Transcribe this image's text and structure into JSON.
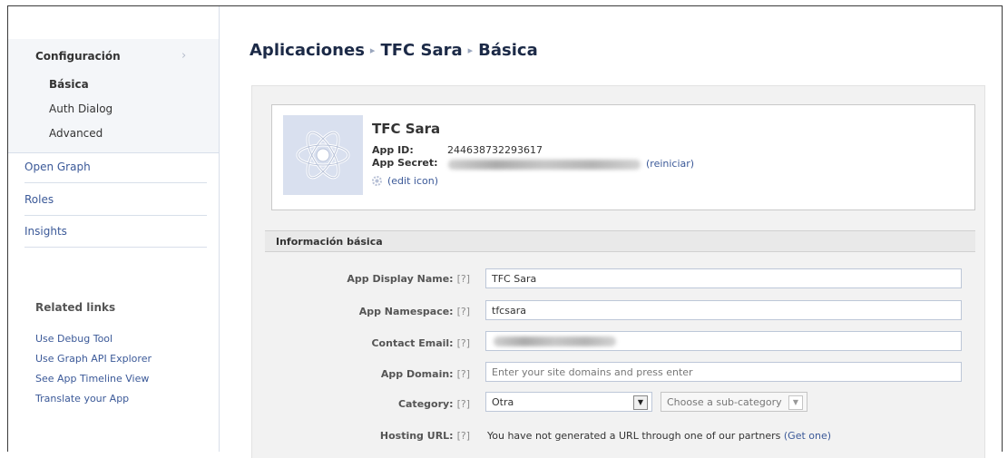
{
  "sidebar": {
    "settings_label": "Configuración",
    "settings_chevron": "›",
    "sub_items": [
      {
        "label": "Básica",
        "active": true
      },
      {
        "label": "Auth Dialog",
        "active": false
      },
      {
        "label": "Advanced",
        "active": false
      }
    ],
    "items": [
      {
        "label": "Open Graph"
      },
      {
        "label": "Roles"
      },
      {
        "label": "Insights"
      }
    ],
    "related_title": "Related links",
    "related_links": [
      {
        "label": "Use Debug Tool"
      },
      {
        "label": "Use Graph API Explorer"
      },
      {
        "label": "See App Timeline View"
      },
      {
        "label": "Translate your App"
      }
    ]
  },
  "breadcrumb": {
    "items": [
      "Aplicaciones",
      "TFC Sara",
      "Básica"
    ],
    "separator": "▸"
  },
  "app": {
    "name": "TFC Sara",
    "app_id_label": "App ID:",
    "app_id": "244638732293617",
    "app_secret_label": "App Secret:",
    "reset_label": "(reiniciar)",
    "edit_icon_label": "(edit icon)",
    "icon": "atom-icon"
  },
  "basic_info": {
    "header": "Información básica",
    "help_marker": "[?]",
    "display_name_label": "App Display Name:",
    "display_name": "TFC Sara",
    "namespace_label": "App Namespace:",
    "namespace": "tfcsara",
    "contact_email_label": "Contact Email:",
    "app_domain_label": "App Domain:",
    "app_domain_placeholder": "Enter your site domains and press enter",
    "category_label": "Category:",
    "category_value": "Otra",
    "subcategory_placeholder": "Choose a sub-category",
    "hosting_url_label": "Hosting URL:",
    "hosting_text": "You have not generated a URL through one of our partners",
    "hosting_link": "(Get one)"
  },
  "colors": {
    "link": "#3b5998",
    "sidebar_bg": "#f4f6f9",
    "section_bg": "#f2f2f2",
    "icon_bg": "#d9e0ef"
  }
}
